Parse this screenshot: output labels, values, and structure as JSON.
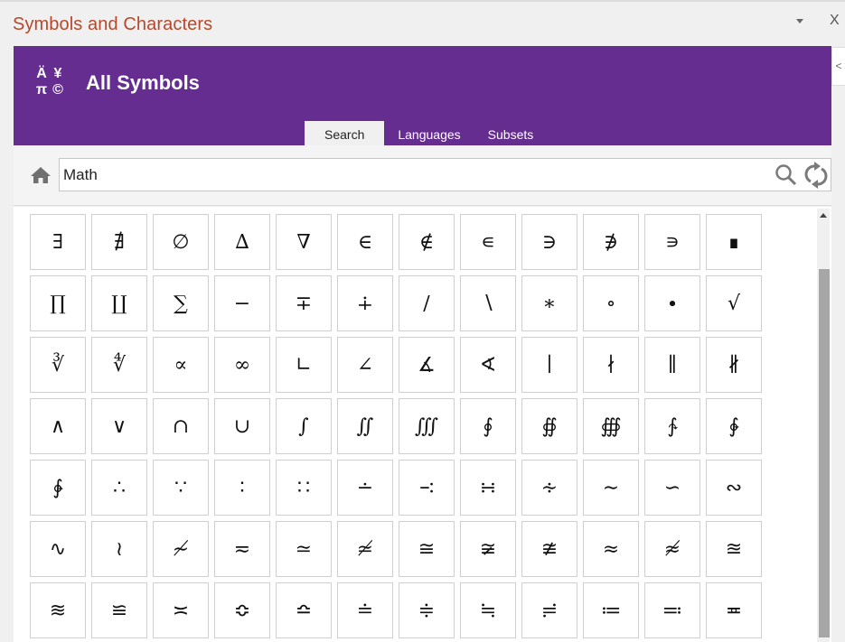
{
  "pane": {
    "title": "Symbols and Characters",
    "close_label": "X"
  },
  "header": {
    "logo_glyphs": [
      "Ä",
      "¥",
      "π",
      "©"
    ],
    "title": "All Symbols",
    "collapse_label": "<",
    "accent_color": "#662d91"
  },
  "tabs": [
    {
      "label": "Search",
      "active": true
    },
    {
      "label": "Languages",
      "active": false
    },
    {
      "label": "Subsets",
      "active": false
    }
  ],
  "search": {
    "value": "Math"
  },
  "symbols": [
    "∃",
    "∄",
    "∅",
    "∆",
    "∇",
    "∈",
    "∉",
    "∊",
    "∋",
    "∌",
    "∍",
    "∎",
    "∏",
    "∐",
    "∑",
    "−",
    "∓",
    "∔",
    "∕",
    "∖",
    "∗",
    "∘",
    "∙",
    "√",
    "∛",
    "∜",
    "∝",
    "∞",
    "∟",
    "∠",
    "∡",
    "∢",
    "∣",
    "∤",
    "∥",
    "∦",
    "∧",
    "∨",
    "∩",
    "∪",
    "∫",
    "∬",
    "∭",
    "∮",
    "∯",
    "∰",
    "∱",
    "∲",
    "∳",
    "∴",
    "∵",
    "∶",
    "∷",
    "∸",
    "∹",
    "∺",
    "∻",
    "∼",
    "∽",
    "∾",
    "∿",
    "≀",
    "≁",
    "≂",
    "≃",
    "≄",
    "≅",
    "≆",
    "≇",
    "≈",
    "≉",
    "≊",
    "≋",
    "≌",
    "≍",
    "≎",
    "≏",
    "≐",
    "≑",
    "≒",
    "≓",
    "≔",
    "≕",
    "≖"
  ]
}
